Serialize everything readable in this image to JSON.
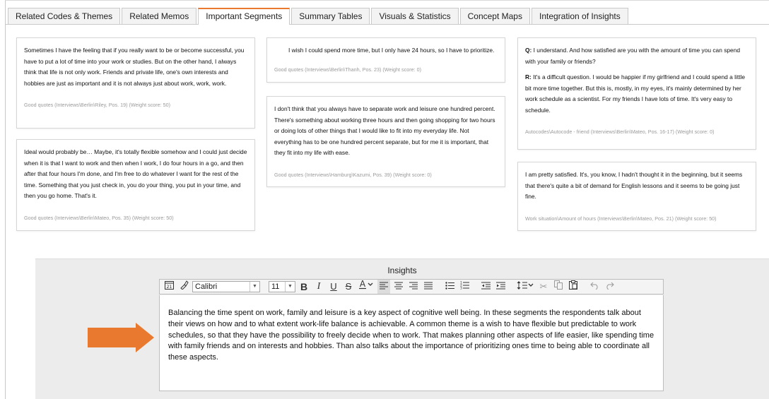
{
  "tabs": [
    {
      "label": "Related Codes & Themes",
      "active": false
    },
    {
      "label": "Related Memos",
      "active": false
    },
    {
      "label": "Important Segments",
      "active": true
    },
    {
      "label": "Summary Tables",
      "active": false
    },
    {
      "label": "Visuals & Statistics",
      "active": false
    },
    {
      "label": "Concept Maps",
      "active": false
    },
    {
      "label": "Integration of Insights",
      "active": false
    }
  ],
  "segments": {
    "s1": {
      "text": "Sometimes I have the feeling that if you really want to be or become successful, you have to put a lot of time into your work or studies. But on the other hand, I always think that life is not only work. Friends and private life, one's own interests and hobbies are just as important and it is not always just about work, work, work.",
      "source": "Good quotes (Interviews\\Berlin\\Riley, Pos. 19) (Weight score: 50)"
    },
    "s2": {
      "text": "Ideal would probably be… Maybe, it's totally flexible somehow and I could just decide when it is that I want to work and then when I work, I do four hours in a go, and then after that four hours I'm done, and I'm free to do whatever I want for the rest of the time. Something that you just check in, you do your thing, you put in your time, and then you go home. That's it.",
      "source": "Good quotes (Interviews\\Berlin\\Mateo, Pos. 35) (Weight score: 50)"
    },
    "s3": {
      "text": "I wish I could spend more time, but I only have 24 hours, so I have to prioritize.",
      "source": "Good quotes (Interviews\\Berlin\\Thanh, Pos. 23) (Weight score: 0)"
    },
    "s4": {
      "text": "I don't think that you always have to separate work and leisure one hundred percent. There's something about working three hours and then going shopping for two hours or doing lots of other things that I would like to fit into my everyday life. Not everything has to be one hundred percent separate, but for me it is important, that they fit into my life with ease.",
      "source": "Good quotes (Interviews\\Hamburg\\Kazumi, Pos. 39) (Weight score: 0)"
    },
    "s5": {
      "q_label": "Q:",
      "q_text": "I understand. And how satisfied are you with the amount of time you can spend with your family or friends?",
      "r_label": "R:",
      "r_text": "It's a difficult question. I would be happier if my girlfriend and I could spend a little bit more time together. But this is, mostly, in my eyes, it's mainly determined by her work schedule as a scientist. For my friends I have lots of time. It's very easy to schedule.",
      "source": "Autocodes\\Autocode - friend (Interviews\\Berlin\\Mateo, Pos. 16-17) (Weight score: 0)"
    },
    "s6": {
      "text": "I am pretty satisfied. It's, you know, I hadn't thought it in the beginning, but it seems that there's quite a bit of demand for English lessons and it seems to be going just fine.",
      "source": "Work situation\\Amount of hours (Interviews\\Berlin\\Mateo, Pos. 21) (Weight score: 50)"
    }
  },
  "insights": {
    "title": "Insights",
    "font_name": "Calibri",
    "font_size": "11",
    "text": "Balancing the time spent on work, family and leisure is a key aspect of cognitive well being. In these segments the respondents talk about their views on how and to what extent work-life balance is achievable. A common theme is a wish to have flexible but predictable to work schedules, so that they have the possibility to freely decide when to work. That makes planning other aspects of life easier, like spending time with family friends and on interests and hobbies. Than also talks about the importance of prioritizing ones time to being able to coordinate all these aspects."
  },
  "colors": {
    "accent": "#e8792f",
    "panel": "#ececec"
  }
}
